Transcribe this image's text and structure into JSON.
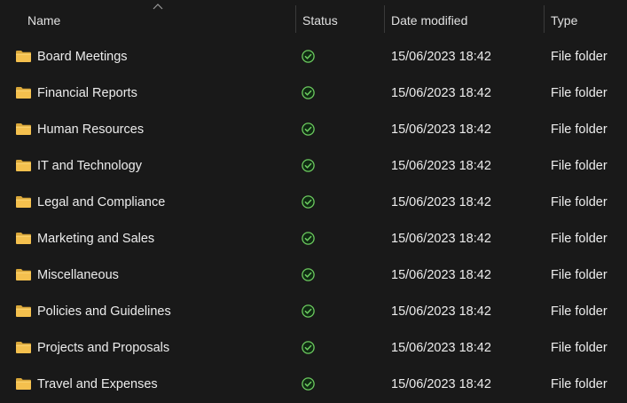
{
  "columns": {
    "name": "Name",
    "status": "Status",
    "date_modified": "Date modified",
    "type": "Type"
  },
  "rows": [
    {
      "name": "Board Meetings",
      "status_icon": "synced-check-icon",
      "date": "15/06/2023 18:42",
      "type": "File folder"
    },
    {
      "name": "Financial Reports",
      "status_icon": "synced-check-icon",
      "date": "15/06/2023 18:42",
      "type": "File folder"
    },
    {
      "name": "Human Resources",
      "status_icon": "synced-check-icon",
      "date": "15/06/2023 18:42",
      "type": "File folder"
    },
    {
      "name": "IT and Technology",
      "status_icon": "synced-check-icon",
      "date": "15/06/2023 18:42",
      "type": "File folder"
    },
    {
      "name": "Legal and Compliance",
      "status_icon": "synced-check-icon",
      "date": "15/06/2023 18:42",
      "type": "File folder"
    },
    {
      "name": "Marketing and Sales",
      "status_icon": "synced-check-icon",
      "date": "15/06/2023 18:42",
      "type": "File folder"
    },
    {
      "name": "Miscellaneous",
      "status_icon": "synced-check-icon",
      "date": "15/06/2023 18:42",
      "type": "File folder"
    },
    {
      "name": "Policies and Guidelines",
      "status_icon": "synced-check-icon",
      "date": "15/06/2023 18:42",
      "type": "File folder"
    },
    {
      "name": "Projects and Proposals",
      "status_icon": "synced-check-icon",
      "date": "15/06/2023 18:42",
      "type": "File folder"
    },
    {
      "name": "Travel and Expenses",
      "status_icon": "synced-check-icon",
      "date": "15/06/2023 18:42",
      "type": "File folder"
    }
  ],
  "colors": {
    "background": "#191919",
    "text": "#ececec",
    "folder": "#f4c04e",
    "status_ok": "#6ccb5f"
  }
}
